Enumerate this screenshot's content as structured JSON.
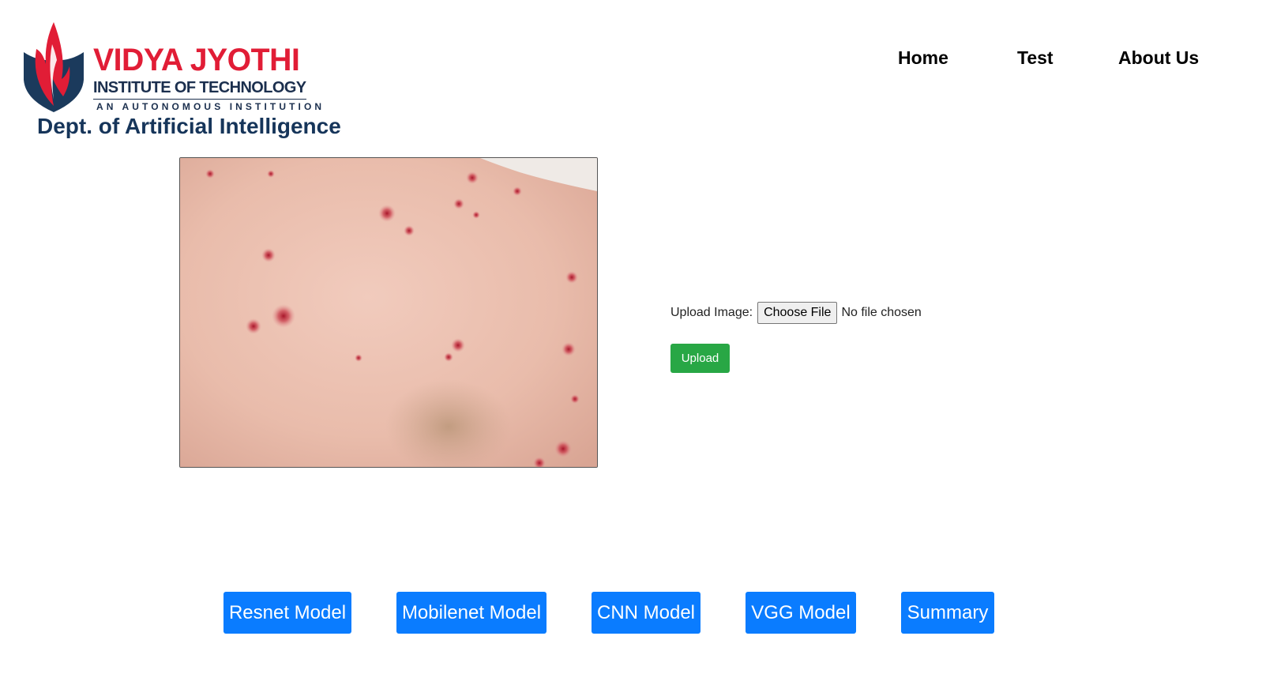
{
  "logo": {
    "title": "VIDYA JYOTHI",
    "subtitle": "INSTITUTE OF TECHNOLOGY",
    "tagline": "AN AUTONOMOUS INSTITUTION",
    "colors": {
      "red": "#e11d36",
      "navy": "#1b2f4e"
    }
  },
  "department": "Dept. of Artificial Intelligence",
  "nav": {
    "home": "Home",
    "test": "Test",
    "about": "About Us"
  },
  "upload": {
    "label": "Upload Image:",
    "choose_file": "Choose File",
    "status": "No file chosen",
    "submit": "Upload",
    "submit_color": "#28a745"
  },
  "models": {
    "resnet": "Resnet Model",
    "mobilenet": "Mobilenet Model",
    "cnn": "CNN Model",
    "vgg": "VGG Model",
    "summary": "Summary",
    "button_color": "#0a7cff"
  }
}
